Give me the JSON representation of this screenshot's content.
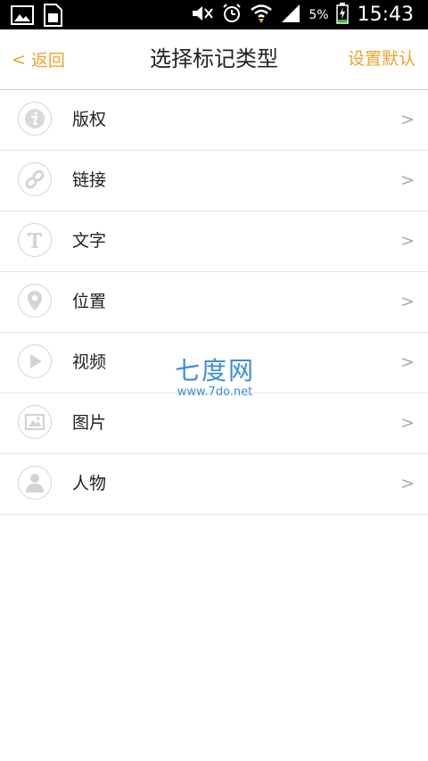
{
  "status_bar": {
    "battery_percent": "5%",
    "time": "15:43",
    "icons": [
      "image-icon",
      "sim-card-icon",
      "mute-icon",
      "alarm-icon",
      "wifi-icon",
      "signal-icon",
      "battery-charging-icon"
    ]
  },
  "header": {
    "back_chevron": "<",
    "back_label": "返回",
    "title": "选择标记类型",
    "set_default_label": "设置默认"
  },
  "list": {
    "items": [
      {
        "label": "版权",
        "icon": "info-icon",
        "chevron": ">"
      },
      {
        "label": "链接",
        "icon": "link-icon",
        "chevron": ">"
      },
      {
        "label": "文字",
        "icon": "text-icon",
        "chevron": ">"
      },
      {
        "label": "位置",
        "icon": "location-pin-icon",
        "chevron": ">"
      },
      {
        "label": "视频",
        "icon": "play-icon",
        "chevron": ">"
      },
      {
        "label": "图片",
        "icon": "picture-icon",
        "chevron": ">"
      },
      {
        "label": "人物",
        "icon": "person-icon",
        "chevron": ">"
      }
    ]
  },
  "watermark": {
    "text": "七度网",
    "url": "www.7do.net"
  },
  "colors": {
    "accent": "#e9a430",
    "icon_gray": "#d4d4d4",
    "chevron_gray": "#a8a8a8",
    "watermark_blue": "#3d8be0"
  }
}
